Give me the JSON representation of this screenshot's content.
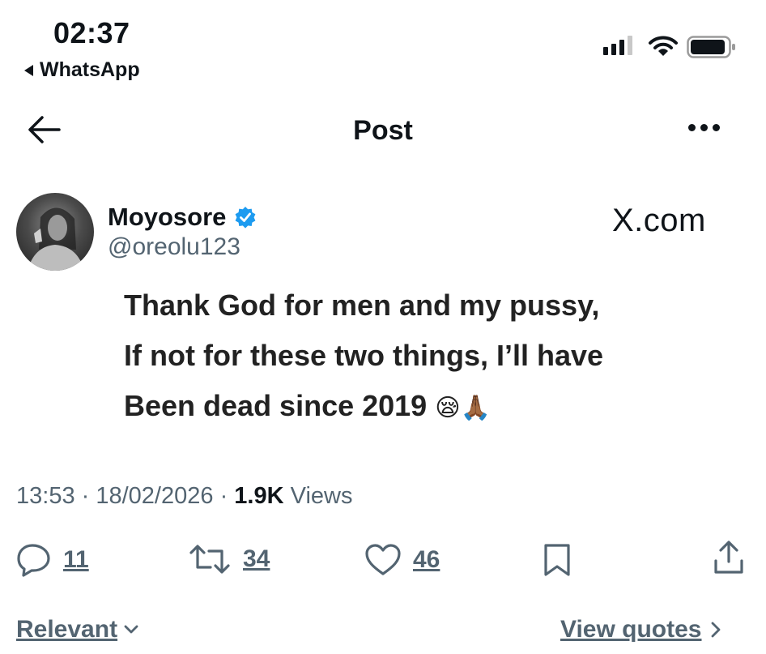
{
  "status_bar": {
    "time": "02:37",
    "back_app_label": "WhatsApp"
  },
  "header": {
    "title": "Post"
  },
  "author": {
    "name": "Moyosore",
    "handle": "@oreolu123",
    "watermark": "X.com"
  },
  "post": {
    "lines": [
      "Thank God for men and my pussy,",
      "If not for these two things, I’ll have",
      "Been dead since 2019 "
    ],
    "emoji": "😪🙏🏾",
    "time": "13:53",
    "date": "18/02/2026",
    "views_count": "1.9K",
    "views_label": "Views"
  },
  "actions": {
    "replies": "11",
    "reposts": "34",
    "likes": "46"
  },
  "footer": {
    "sort_label": "Relevant",
    "view_quotes_label": "View quotes"
  },
  "colors": {
    "text": "#0f1419",
    "muted": "#536471",
    "verified": "#1d9bf0"
  }
}
